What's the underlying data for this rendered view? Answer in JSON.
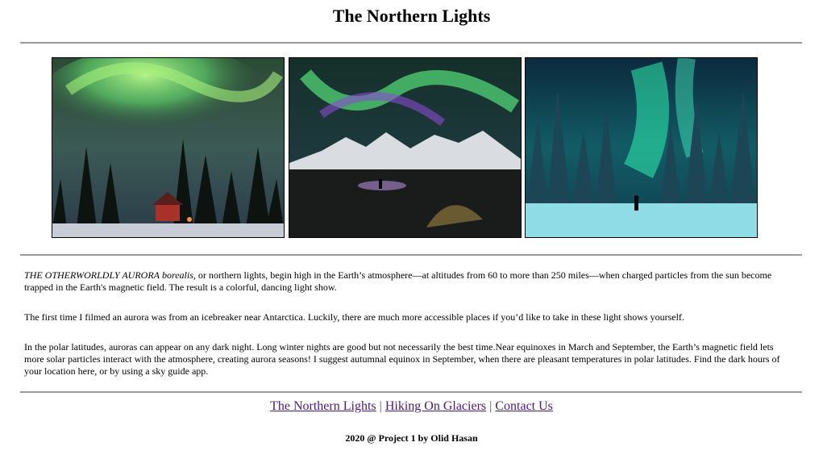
{
  "page": {
    "title": "The Northern Lights"
  },
  "gallery": [
    {
      "icon": "aurora-cabin-photo"
    },
    {
      "icon": "aurora-mountain-photo"
    },
    {
      "icon": "aurora-forest-photo"
    }
  ],
  "article": {
    "p1_lead": "THE OTHERWORLDLY AURORA",
    "p1_lead_italic": "borealis,",
    "p1_rest": " or northern lights, begin high in the Earth’s atmosphere—at altitudes from 60 to more than 250 miles—when charged particles from the sun become trapped in the Earth's magnetic field. The result is a colorful, dancing light show.",
    "p2": "The first time I filmed an aurora was from an icebreaker near Antarctica. Luckily, there are much more accessible places if you’d like to take in these light shows yourself.",
    "p3": "In the polar latitudes, auroras can appear on any dark night. Long winter nights are good but not necessarily the best time.Near equinoxes in March and September, the Earth’s magnetic field lets more solar particles interact with the atmosphere, creating aurora seasons! I suggest autumnal equinox in September, when there are pleasant temperatures in polar latitudes. Find the dark hours of your location here, or by using a sky guide app."
  },
  "footer": {
    "links": [
      "The Northern Lights",
      "Hiking On Glaciers",
      "Contact Us"
    ],
    "separator": "|",
    "credit": "2020 @ Project 1 by Olid Hasan"
  }
}
